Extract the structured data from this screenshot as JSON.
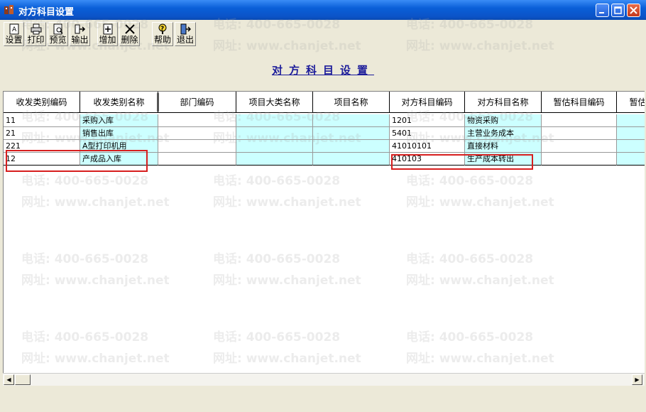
{
  "window": {
    "title": "对方科目设置"
  },
  "toolbar": [
    {
      "label": "设置",
      "icon": "settings-icon"
    },
    {
      "label": "打印",
      "icon": "print-icon"
    },
    {
      "label": "预览",
      "icon": "preview-icon"
    },
    {
      "label": "输出",
      "icon": "export-icon"
    },
    {
      "label": "增加",
      "icon": "add-icon"
    },
    {
      "label": "删除",
      "icon": "delete-icon"
    },
    {
      "label": "帮助",
      "icon": "help-icon"
    },
    {
      "label": "退出",
      "icon": "exit-icon"
    }
  ],
  "page": {
    "heading": "对方科目设置"
  },
  "table": {
    "columns": [
      "收发类别编码",
      "收发类别名称",
      "部门编码",
      "项目大类名称",
      "项目名称",
      "对方科目编码",
      "对方科目名称",
      "暂估科目编码",
      "暂估"
    ],
    "rows": [
      [
        "11",
        "采购入库",
        "",
        "",
        "",
        "1201",
        "物资采购",
        "",
        ""
      ],
      [
        "21",
        "销售出库",
        "",
        "",
        "",
        "5401",
        "主营业务成本",
        "",
        ""
      ],
      [
        "221",
        "A型打印机用",
        "",
        "",
        "",
        "41010101",
        "直接材料",
        "",
        ""
      ],
      [
        "12",
        "产成品入库",
        "",
        "",
        "",
        "410103",
        "生产成本转出",
        "",
        ""
      ]
    ]
  },
  "watermark": {
    "phone": "电话: 400-665-0028",
    "site": "网址: www.chanjet.net"
  },
  "colors": {
    "titlebar": "#0A5FD8",
    "cyan_cell": "#CCFFFF",
    "highlight": "#D71E1E",
    "heading": "#1C1C9A"
  }
}
